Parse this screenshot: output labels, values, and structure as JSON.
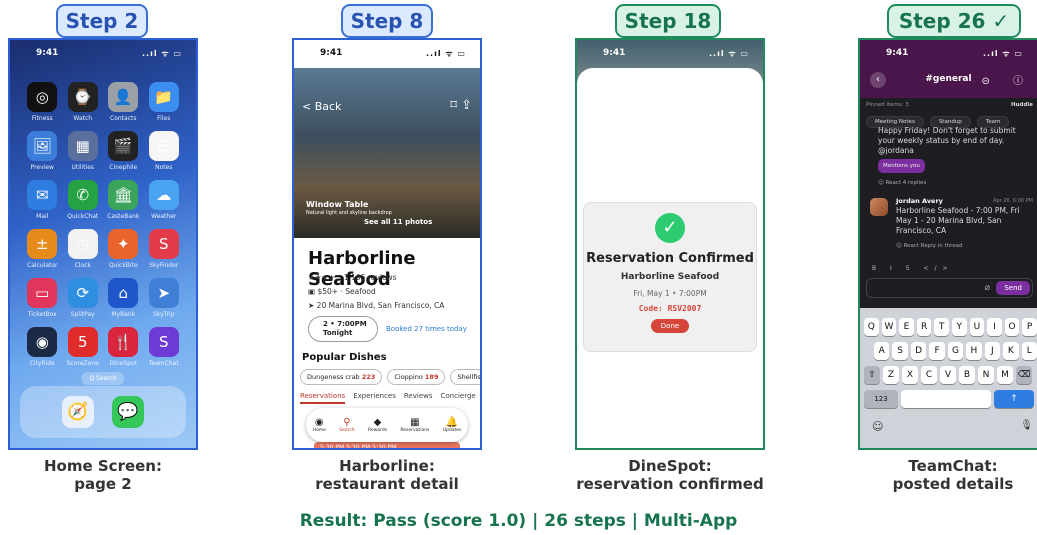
{
  "panels": [
    {
      "step": "Step 2",
      "caption_line1": "Home Screen:",
      "caption_line2": "page 2"
    },
    {
      "step": "Step 8",
      "caption_line1": "Harborline:",
      "caption_line2": "restaurant detail"
    },
    {
      "step": "Step 18",
      "caption_line1": "DineSpot:",
      "caption_line2": "reservation confirmed"
    },
    {
      "step": "Step 26 ✓",
      "caption_line1": "TeamChat:",
      "caption_line2": "posted details"
    }
  ],
  "status_time": "9:41",
  "status_icons": "..ıl ᯤ ▭",
  "home": {
    "apps": [
      {
        "label": "Fitness",
        "icon": "◎",
        "color": "#111111"
      },
      {
        "label": "Watch",
        "icon": "⌚",
        "color": "#222222"
      },
      {
        "label": "Contacts",
        "icon": "👤",
        "color": "#9aa0a6"
      },
      {
        "label": "Files",
        "icon": "📁",
        "color": "#3b8ef0"
      },
      {
        "label": "Preview",
        "icon": "🖼",
        "color": "#3c7dd9"
      },
      {
        "label": "Utilities",
        "icon": "▦",
        "color": "#5a6f9c"
      },
      {
        "label": "Cinephile",
        "icon": "🎬",
        "color": "#222222"
      },
      {
        "label": "Notes",
        "icon": "☰",
        "color": "#f6f6f6"
      },
      {
        "label": "Mail",
        "icon": "✉",
        "color": "#2f7de1"
      },
      {
        "label": "QuickChat",
        "icon": "✆",
        "color": "#25a244"
      },
      {
        "label": "CasteBank",
        "icon": "🏛",
        "color": "#3aa35c"
      },
      {
        "label": "Weather",
        "icon": "☁",
        "color": "#4aa3f0"
      },
      {
        "label": "Calculator",
        "icon": "±",
        "color": "#e68a1c"
      },
      {
        "label": "Clock",
        "icon": "◷",
        "color": "#f2f2f2"
      },
      {
        "label": "QuickBite",
        "icon": "✦",
        "color": "#e8642c"
      },
      {
        "label": "SkyFinder",
        "icon": "S",
        "color": "#e23b4a"
      },
      {
        "label": "TicketBox",
        "icon": "▭",
        "color": "#e0365b"
      },
      {
        "label": "SplitPay",
        "icon": "⟳",
        "color": "#2e8fe0"
      },
      {
        "label": "MyBank",
        "icon": "⌂",
        "color": "#1f56c9"
      },
      {
        "label": "SkyTrip",
        "icon": "➤",
        "color": "#3f7fd6"
      },
      {
        "label": "CityRide",
        "icon": "◉",
        "color": "#1a2a44"
      },
      {
        "label": "ScoreZone",
        "icon": "5",
        "color": "#e02b2b"
      },
      {
        "label": "DineSpot",
        "icon": "🍴",
        "color": "#d9253d"
      },
      {
        "label": "TeamChat",
        "icon": "S",
        "color": "#6d3ad4"
      }
    ],
    "search": "Q Search",
    "dock": [
      {
        "name": "safari",
        "icon": "🧭",
        "color": "#e8f0ff"
      },
      {
        "name": "messages",
        "icon": "💬",
        "color": "#35c759"
      }
    ]
  },
  "harborline": {
    "back": "< Back",
    "hero_title": "Window Table",
    "hero_sub": "Natural light and skyline backdrop",
    "see_all": "See all 11 photos",
    "name": "Harborline Seafood",
    "rating": "★★★★☆ 1,105 reviews",
    "price": "▣ $50+ · Seafood",
    "address": "➤ 20 Marina Blvd, San Francisco, CA",
    "reserve_line1": "2 • 7:00PM",
    "reserve_line2": "Tonight",
    "booked": "Booked 27 times today",
    "popular": "Popular Dishes",
    "dishes": [
      {
        "name": "Dungeness crab",
        "count": "223"
      },
      {
        "name": "Cioppino",
        "count": "189"
      },
      {
        "name": "Shellfish",
        "count": ""
      }
    ],
    "tabs": [
      "Reservations",
      "Experiences",
      "Reviews",
      "Concierge"
    ],
    "nav": [
      {
        "label": "Home",
        "icon": "◉"
      },
      {
        "label": "Search",
        "icon": "⚲"
      },
      {
        "label": "Rewards",
        "icon": "◆"
      },
      {
        "label": "Reservations",
        "icon": "▦"
      },
      {
        "label": "Updates",
        "icon": "🔔"
      }
    ],
    "times": "5:30 PM     5:30 PM     5:30 PM"
  },
  "dinespot": {
    "title": "Reservation Confirmed",
    "restaurant": "Harborline Seafood",
    "date": "Fri, May 1 • 7:00PM",
    "code": "Code: RSV2007",
    "done": "Done"
  },
  "teamchat": {
    "channel": "#general",
    "pinned": "Pinned items: 3",
    "huddle": "Huddle",
    "pins": [
      "Meeting Notes",
      "Standup",
      "Team"
    ],
    "msg1": "Happy Friday! Don't forget to submit your weekly status by end of day. @jordana",
    "mentions": "Mentions you",
    "msg1_react": "☺ React    4 replies",
    "author": "Jordan Avery",
    "timestamp": "Apr 26, 6:00 PM",
    "msg2": "Harborline Seafood - 7:00 PM, Fri May 1 - 20 Marina Blvd, San Francisco, CA",
    "msg2_react": "☺ React    Reply in thread",
    "format": "B I S </>",
    "send": "Send",
    "kb_row1": [
      "Q",
      "W",
      "E",
      "R",
      "T",
      "Y",
      "U",
      "I",
      "O",
      "P"
    ],
    "kb_row2": [
      "A",
      "S",
      "D",
      "F",
      "G",
      "H",
      "J",
      "K",
      "L"
    ],
    "kb_row3": [
      "⇧",
      "Z",
      "X",
      "C",
      "V",
      "B",
      "N",
      "M",
      "⌫"
    ],
    "kb_123": "123",
    "kb_return": "↑"
  },
  "result": "Result: Pass (score 1.0)  |  26 steps  |  Multi-App"
}
